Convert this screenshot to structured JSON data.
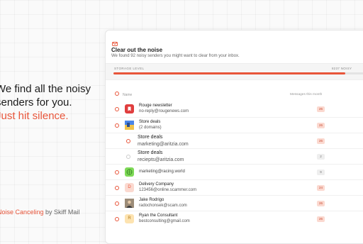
{
  "hero": {
    "line1": "We find all the noisy",
    "line2": "senders for you.",
    "line3": "Just hit silence."
  },
  "footer": {
    "product": "Noise Canceling",
    "by": " by Skiff Mail"
  },
  "panel": {
    "title": "Clear out the noise",
    "subtitle": "We found 92 noisy senders you might want to clear from your inbox.",
    "storage_label": "STORAGE LEVEL",
    "storage_count": "8237 NOISY",
    "storage_level": 0.92,
    "accent_color": "#e8553a"
  },
  "columns": {
    "name": "Name",
    "messages": "Messages this month"
  },
  "senders": [
    {
      "title": "Rouge newsletter",
      "subtitle": "no-reply@rougenews.com",
      "count": "26",
      "icon": "bookmark-icon"
    },
    {
      "title": "Store deals",
      "subtitle": "(2 domains)",
      "count": "26",
      "icon": "store-icon"
    },
    {
      "title": "Store deals",
      "subtitle": "marketing@aritzia.com",
      "count": "26"
    },
    {
      "title": "Store deals",
      "subtitle": "reciepts@aritzia.com",
      "count": "2"
    },
    {
      "single": "marketing@racing.world",
      "count": "9",
      "icon": "globe-icon"
    },
    {
      "title": "Delivery Company",
      "subtitle": "123456@online.scammer.com",
      "count": "24",
      "initial": "D"
    },
    {
      "title": "Jake Rodrigo",
      "subtitle": "radochonsek@scam.com",
      "count": "26",
      "icon": "person-photo-icon"
    },
    {
      "title": "Ryan the Consultant",
      "subtitle": "bestconsulting@gmail.com",
      "count": "26",
      "initial": "R"
    }
  ]
}
